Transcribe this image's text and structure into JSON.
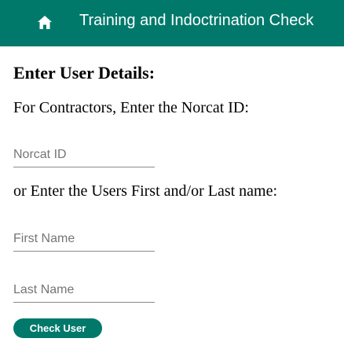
{
  "header": {
    "title": "Training and Indoctrination Check",
    "home_icon": "home-icon",
    "background_color": "#00796b"
  },
  "form": {
    "heading": "Enter User Details:",
    "contractor_prompt": "For Contractors, Enter the Norcat ID:",
    "norcat_id": {
      "placeholder": "Norcat ID",
      "value": ""
    },
    "name_prompt": "or Enter the Users First and/or Last name:",
    "first_name": {
      "placeholder": "First Name",
      "value": ""
    },
    "last_name": {
      "placeholder": "Last Name",
      "value": ""
    },
    "submit_label": "Check User"
  }
}
